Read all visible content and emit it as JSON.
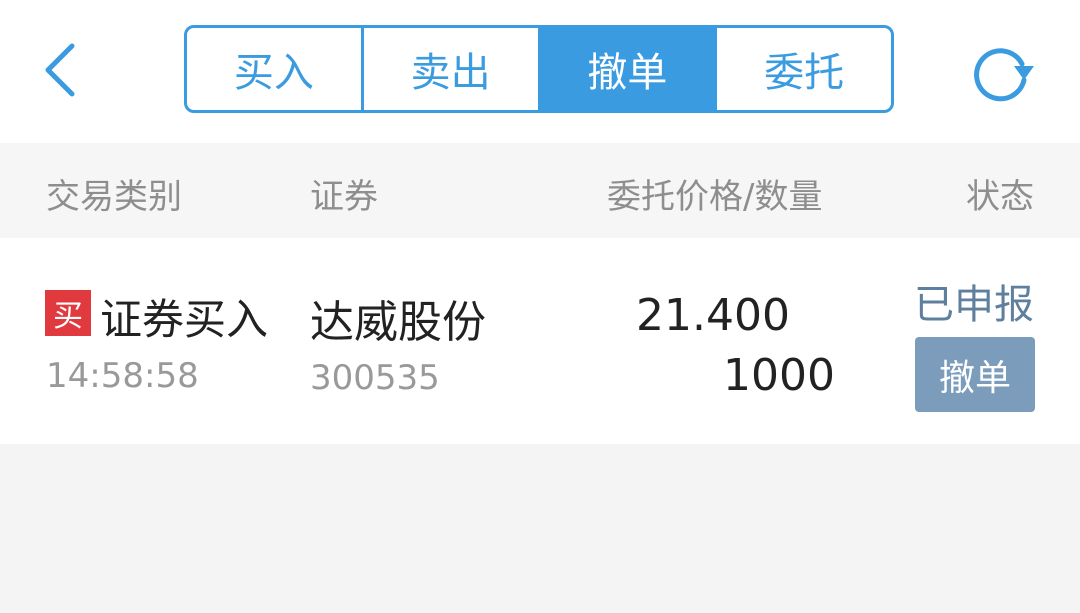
{
  "nav": {
    "back_icon": "chevron-left-icon",
    "refresh_icon": "refresh-icon",
    "accent_color": "#3a9be0",
    "tabs": [
      {
        "label": "买入"
      },
      {
        "label": "卖出"
      },
      {
        "label": "撤单"
      },
      {
        "label": "委托"
      }
    ],
    "active_tab": "撤单"
  },
  "table": {
    "headers": {
      "type": "交易类别",
      "security": "证券",
      "price_qty": "委托价格/数量",
      "status": "状态"
    },
    "rows": [
      {
        "tag": "买",
        "type": "证券买入",
        "time": "14:58:58",
        "security_name": "达威股份",
        "security_code": "300535",
        "price": "21.400",
        "quantity": "1000",
        "status": "已申报",
        "action": "撤单"
      }
    ]
  }
}
